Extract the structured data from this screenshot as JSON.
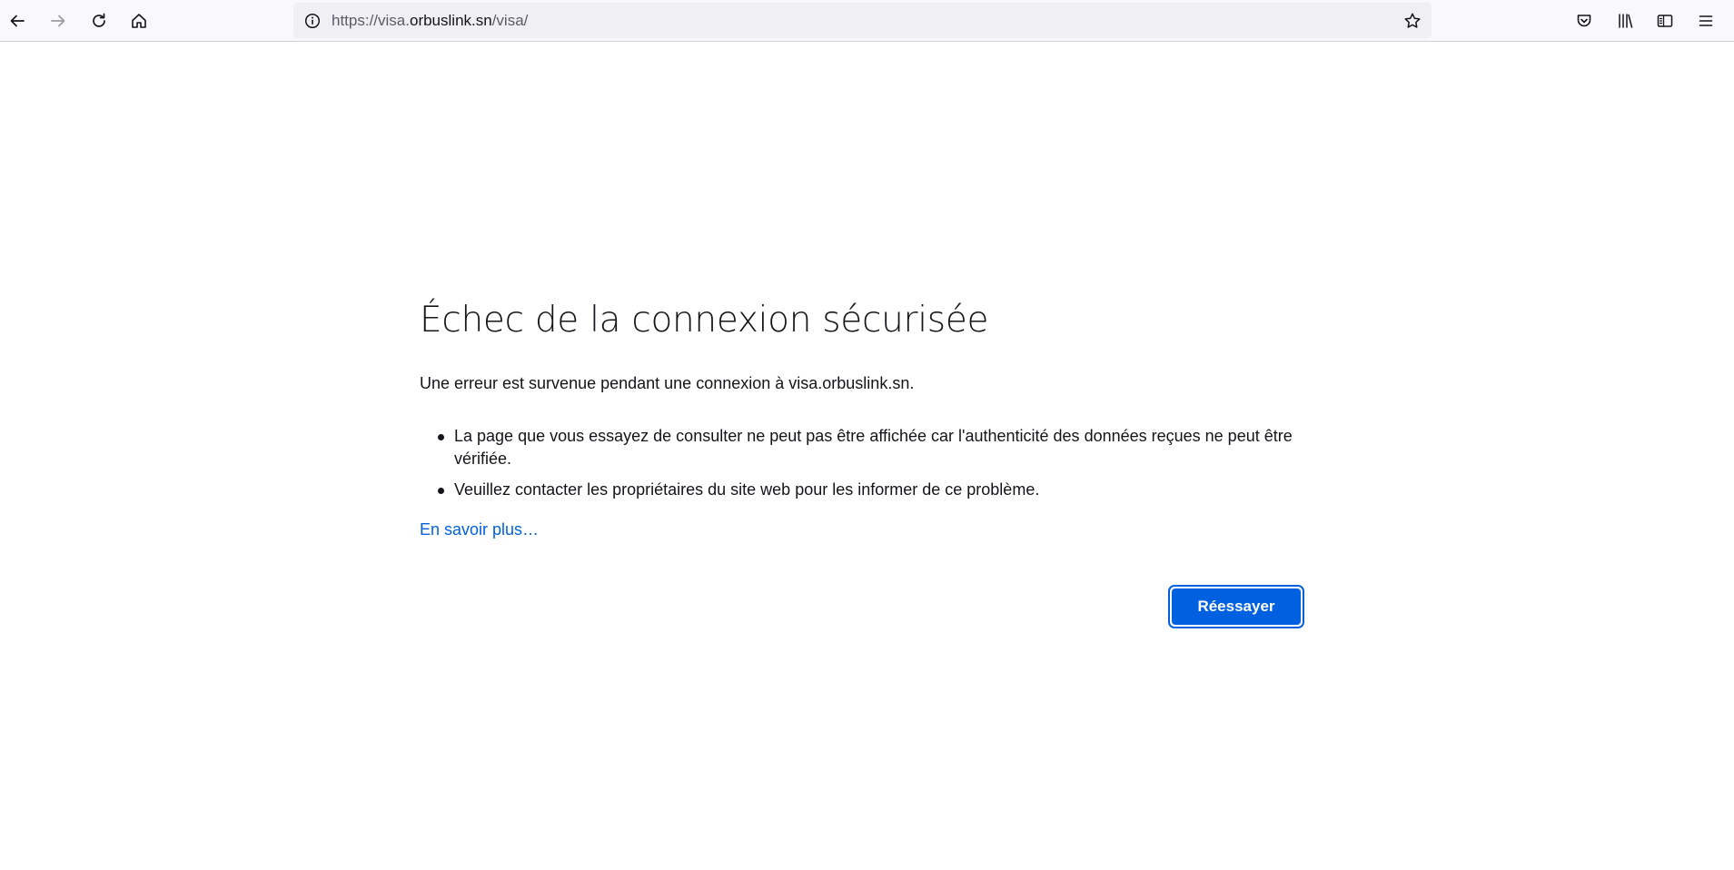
{
  "browser": {
    "nav": {
      "back_icon": "arrow-left-icon",
      "forward_icon": "arrow-right-icon",
      "reload_icon": "reload-icon",
      "home_icon": "home-icon"
    },
    "urlbar": {
      "scheme": "https://visa.",
      "host": "orbuslink.sn",
      "path": "/visa/",
      "info_icon": "info-icon",
      "bookmark_icon": "star-icon"
    },
    "right_tools": [
      "pocket-icon",
      "library-icon",
      "sidebar-icon",
      "menu-icon"
    ]
  },
  "error_page": {
    "title": "Échec de la connexion sécurisée",
    "intro": "Une erreur est survenue pendant une connexion à visa.orbuslink.sn.",
    "bullets": [
      "La page que vous essayez de consulter ne peut pas être affichée car l'authenticité des données reçues ne peut être vérifiée.",
      "Veuillez contacter les propriétaires du site web pour les informer de ce problème."
    ],
    "learn_more": "En savoir plus…",
    "retry_label": "Réessayer"
  },
  "colors": {
    "accent": "#0061e0",
    "text": "#15141a",
    "toolbar_bg": "#f9f9fb",
    "urlbar_bg": "#f0f0f4"
  }
}
